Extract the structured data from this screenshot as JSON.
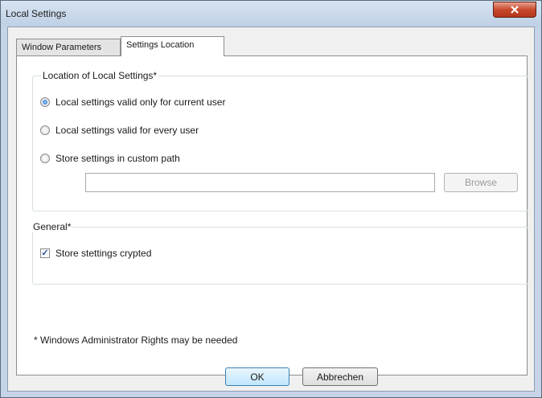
{
  "window": {
    "title": "Local Settings"
  },
  "tabs": [
    {
      "label": "Window Parameters",
      "active": false
    },
    {
      "label": "Settings Location",
      "active": true
    }
  ],
  "location_group": {
    "legend": "Location of Local Settings*",
    "options": [
      {
        "label": "Local settings valid only for current user",
        "selected": true
      },
      {
        "label": "Local settings valid for every user",
        "selected": false
      },
      {
        "label": "Store settings in custom path",
        "selected": false
      }
    ],
    "path_value": "",
    "browse_label": "Browse"
  },
  "general_group": {
    "legend": "General*",
    "crypt_label": "Store stettings crypted",
    "crypt_checked": true
  },
  "footnote": "* Windows Administrator Rights may be needed",
  "buttons": {
    "ok": "OK",
    "cancel": "Abbrechen"
  },
  "colors": {
    "accent": "#2f6fc4",
    "close": "#c8482d"
  }
}
